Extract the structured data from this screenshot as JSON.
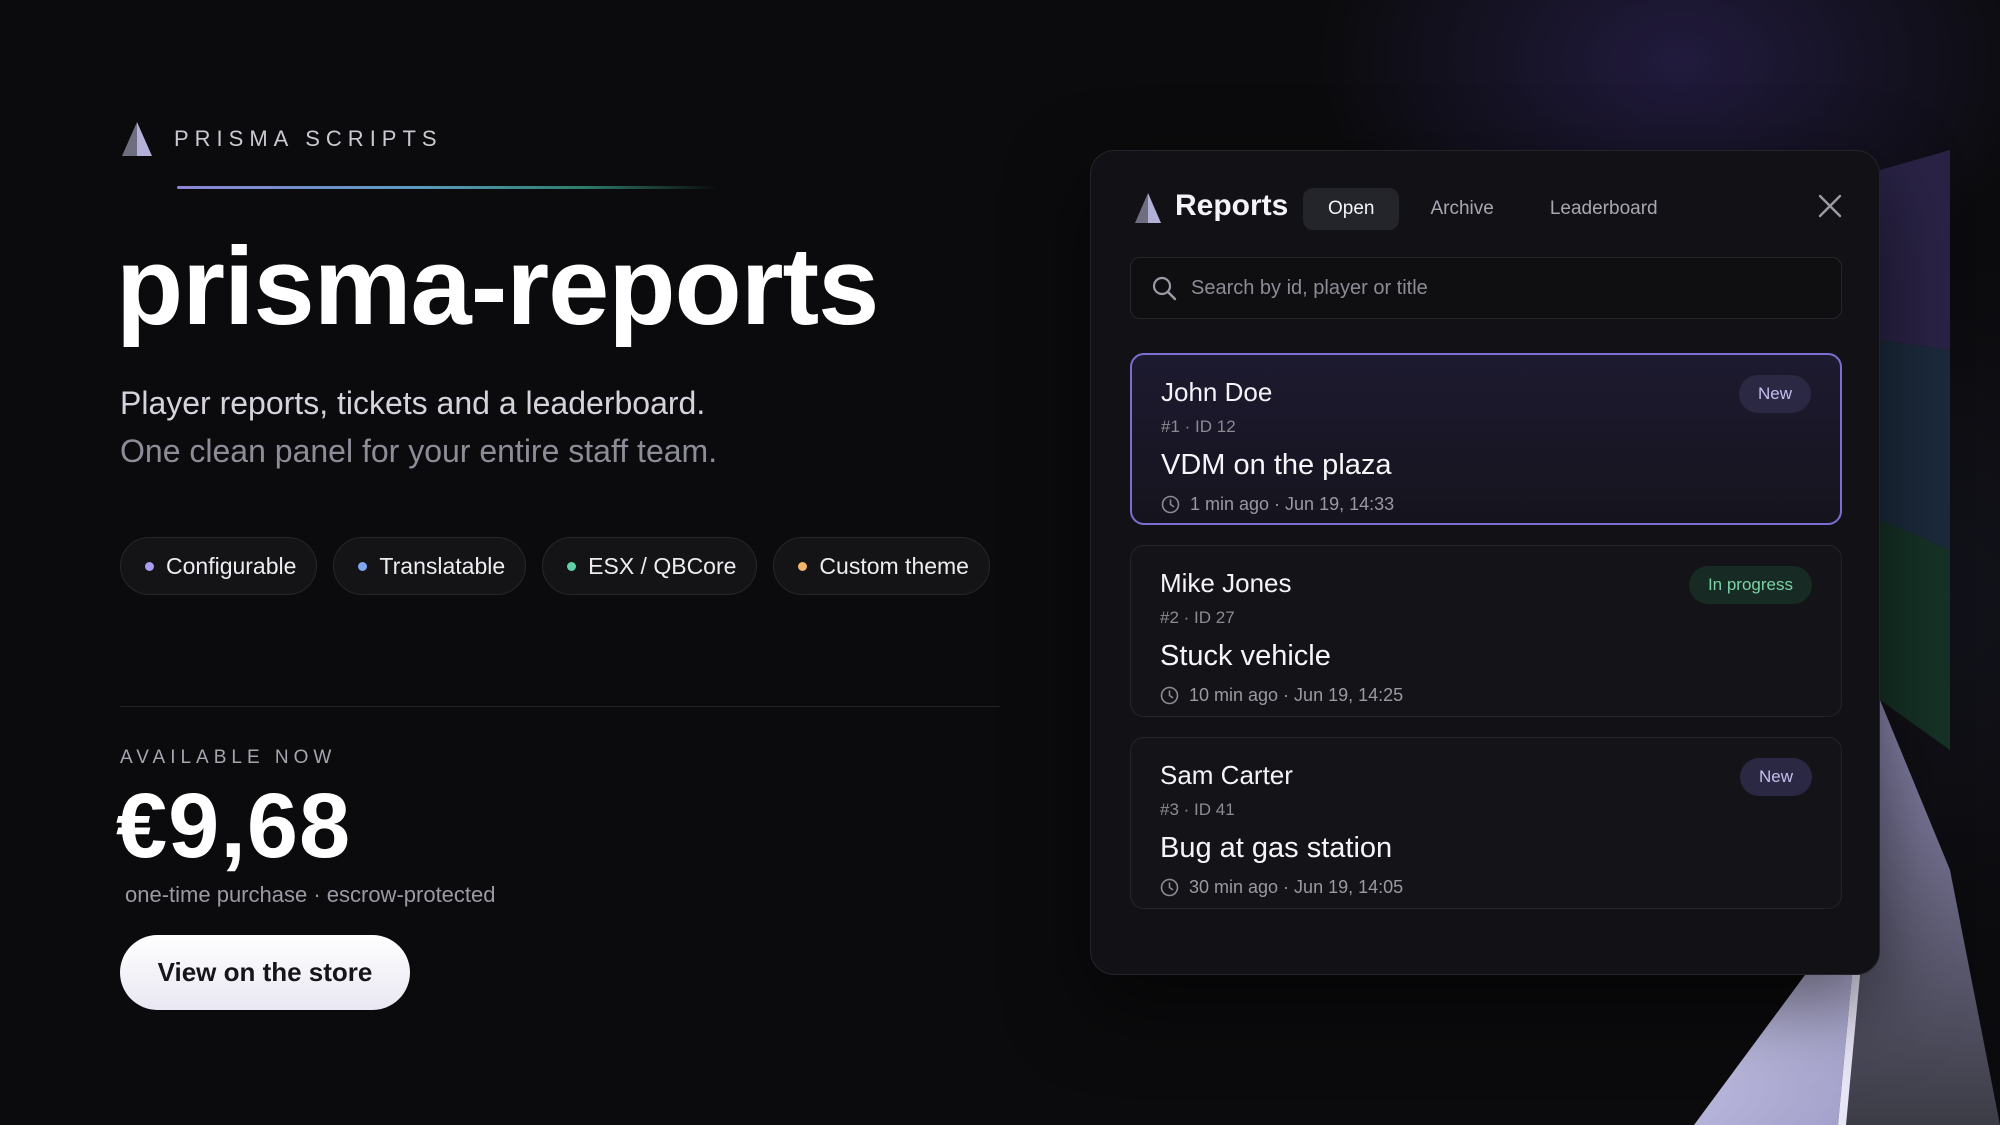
{
  "brand": {
    "name": "PRISMA SCRIPTS",
    "logo_icon": "prisma-triangle-logo"
  },
  "hero": {
    "title": "prisma-reports",
    "subtitle_line1": "Player reports, tickets and a leaderboard.",
    "subtitle_line2": "One clean panel for your entire staff team."
  },
  "features": [
    {
      "label": "Configurable",
      "dot_color": "#a89df0"
    },
    {
      "label": "Translatable",
      "dot_color": "#7fa7f0"
    },
    {
      "label": "ESX / QBCore",
      "dot_color": "#5fd1a8"
    },
    {
      "label": "Custom theme",
      "dot_color": "#f0b46a"
    }
  ],
  "pricing": {
    "availability": "AVAILABLE NOW",
    "price": "€9,68",
    "note": "one-time purchase · escrow-protected",
    "cta_label": "View on the store"
  },
  "panel": {
    "title": "Reports",
    "tabs": [
      {
        "label": "Open",
        "active": true
      },
      {
        "label": "Archive",
        "active": false
      },
      {
        "label": "Leaderboard",
        "active": false
      }
    ],
    "close_icon": "close-icon",
    "search": {
      "placeholder": "Search by id, player or title",
      "value": ""
    },
    "reports": [
      {
        "player": "John Doe",
        "meta": "#1 · ID 12",
        "title": "VDM on the plaza",
        "time": "1 min ago · Jun 19, 14:33",
        "status": "New",
        "status_type": "new",
        "selected": true
      },
      {
        "player": "Mike Jones",
        "meta": "#2 · ID 27",
        "title": "Stuck vehicle",
        "time": "10 min ago · Jun 19, 14:25",
        "status": "In progress",
        "status_type": "progress",
        "selected": false
      },
      {
        "player": "Sam Carter",
        "meta": "#3 · ID 41",
        "title": "Bug at gas station",
        "time": "30 min ago · Jun 19, 14:05",
        "status": "New",
        "status_type": "new",
        "selected": false
      }
    ]
  },
  "colors": {
    "accent": "#7a6fd0",
    "background": "#0b0b0d",
    "panel": "#121216",
    "status_new": "#c4bff0",
    "status_progress": "#7ad2a6"
  }
}
